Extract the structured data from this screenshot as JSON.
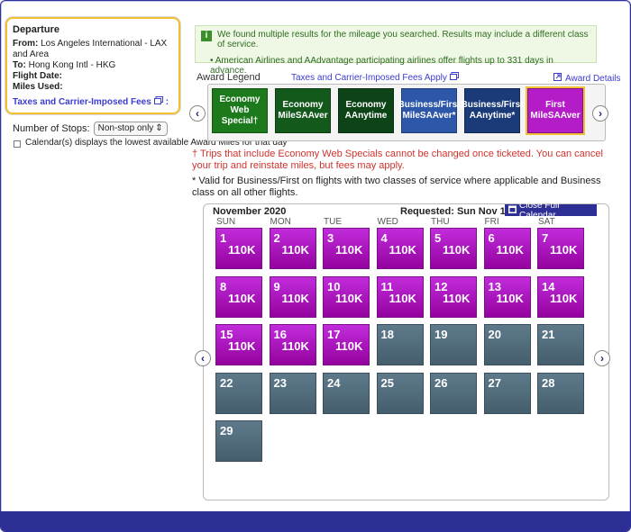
{
  "departure": {
    "title": "Departure",
    "from_label": "From:",
    "from_value": "Los Angeles International - LAX and Area",
    "to_label": "To:",
    "to_value": "Hong Kong Intl - HKG",
    "flight_date_label": "Flight Date:",
    "miles_used_label": "Miles Used:",
    "taxes_link": "Taxes and Carrier-Imposed Fees"
  },
  "filters": {
    "stops_label": "Number of Stops:",
    "stops_value": "Non-stop only",
    "calendar_note": "Calendar(s) displays the lowest available Award Miles for that day"
  },
  "notice": {
    "line1": "We found multiple results for the mileage you searched. Results may include a different class of service.",
    "line2": "American Airlines and AAdvantage participating airlines offer flights up to 331 days in advance."
  },
  "legend": {
    "title": "Award Legend",
    "taxes_link": "Taxes and Carrier-Imposed Fees Apply",
    "details_link": "Award Details",
    "items": [
      {
        "line1": "Economy",
        "line2": "Web Special†",
        "color": "#1c7a1c"
      },
      {
        "line1": "Economy",
        "line2": "MileSAAver",
        "color": "#14591c"
      },
      {
        "line1": "Economy",
        "line2": "AAnytime",
        "color": "#0c4418"
      },
      {
        "line1": "Business/First",
        "line2": "MileSAAver*",
        "color": "#2d57a8"
      },
      {
        "line1": "Business/First",
        "line2": "AAnytime*",
        "color": "#1a3a78"
      },
      {
        "line1": "First",
        "line2": "MileSAAver",
        "color": "#b41cc8"
      }
    ]
  },
  "notes": {
    "dagger": "† Trips that include Economy Web Specials cannot be changed once ticketed. You can cancel your trip and reinstate miles, but fees may apply.",
    "asterisk": "* Valid for Business/First on flights with two classes of service where applicable and Business class on all other flights."
  },
  "calendar": {
    "month": "November 2020",
    "requested": "Requested: Sun Nov 15",
    "close_button": "Close Full Calendar",
    "weekdays": [
      "SUN",
      "MON",
      "TUE",
      "WED",
      "THU",
      "FRI",
      "SAT"
    ],
    "days": [
      {
        "day": "1",
        "miles": "110K"
      },
      {
        "day": "2",
        "miles": "110K"
      },
      {
        "day": "3",
        "miles": "110K"
      },
      {
        "day": "4",
        "miles": "110K"
      },
      {
        "day": "5",
        "miles": "110K"
      },
      {
        "day": "6",
        "miles": "110K"
      },
      {
        "day": "7",
        "miles": "110K"
      },
      {
        "day": "8",
        "miles": "110K"
      },
      {
        "day": "9",
        "miles": "110K"
      },
      {
        "day": "10",
        "miles": "110K"
      },
      {
        "day": "11",
        "miles": "110K"
      },
      {
        "day": "12",
        "miles": "110K"
      },
      {
        "day": "13",
        "miles": "110K"
      },
      {
        "day": "14",
        "miles": "110K"
      },
      {
        "day": "15",
        "miles": "110K"
      },
      {
        "day": "16",
        "miles": "110K"
      },
      {
        "day": "17",
        "miles": "110K"
      },
      {
        "day": "18",
        "miles": ""
      },
      {
        "day": "19",
        "miles": ""
      },
      {
        "day": "20",
        "miles": ""
      },
      {
        "day": "21",
        "miles": ""
      },
      {
        "day": "22",
        "miles": ""
      },
      {
        "day": "23",
        "miles": ""
      },
      {
        "day": "24",
        "miles": ""
      },
      {
        "day": "25",
        "miles": ""
      },
      {
        "day": "26",
        "miles": ""
      },
      {
        "day": "27",
        "miles": ""
      },
      {
        "day": "28",
        "miles": ""
      },
      {
        "day": "29",
        "miles": ""
      }
    ]
  },
  "colors": {
    "available_day": "#a915c0",
    "unavailable_day": "#4f6877",
    "brand_navy": "#2d2f95",
    "highlight_gold": "#f3c033"
  }
}
